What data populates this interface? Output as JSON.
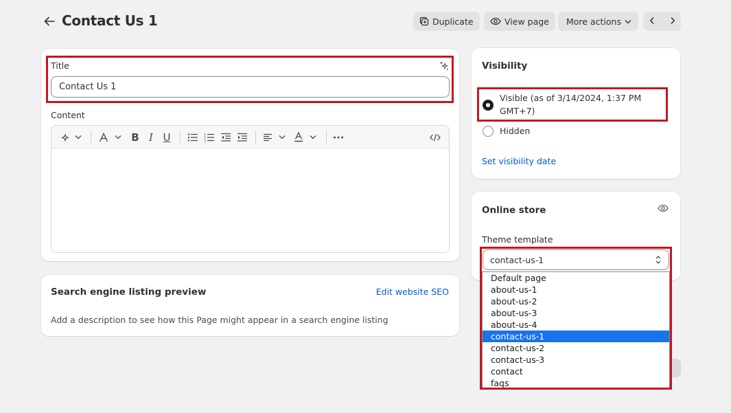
{
  "header": {
    "title": "Contact Us 1",
    "duplicate_label": "Duplicate",
    "view_page_label": "View page",
    "more_actions_label": "More actions"
  },
  "title_field": {
    "label": "Title",
    "value": "Contact Us 1"
  },
  "content_field": {
    "label": "Content"
  },
  "seo": {
    "heading": "Search engine listing preview",
    "edit_link": "Edit website SEO",
    "description": "Add a description to see how this Page might appear in a search engine listing"
  },
  "visibility": {
    "heading": "Visibility",
    "visible_label": "Visible (as of 3/14/2024, 1:37 PM GMT+7)",
    "hidden_label": "Hidden",
    "set_date_link": "Set visibility date"
  },
  "online_store": {
    "heading": "Online store",
    "template_label": "Theme template",
    "selected": "contact-us-1",
    "options": [
      "Default page",
      "about-us-1",
      "about-us-2",
      "about-us-3",
      "about-us-4",
      "contact-us-1",
      "contact-us-2",
      "contact-us-3",
      "contact",
      "faqs"
    ]
  },
  "colors": {
    "background": "#f1f1f1",
    "link": "#005bd3",
    "highlight_border": "#c8161d",
    "selected_option": "#1a73e8"
  }
}
